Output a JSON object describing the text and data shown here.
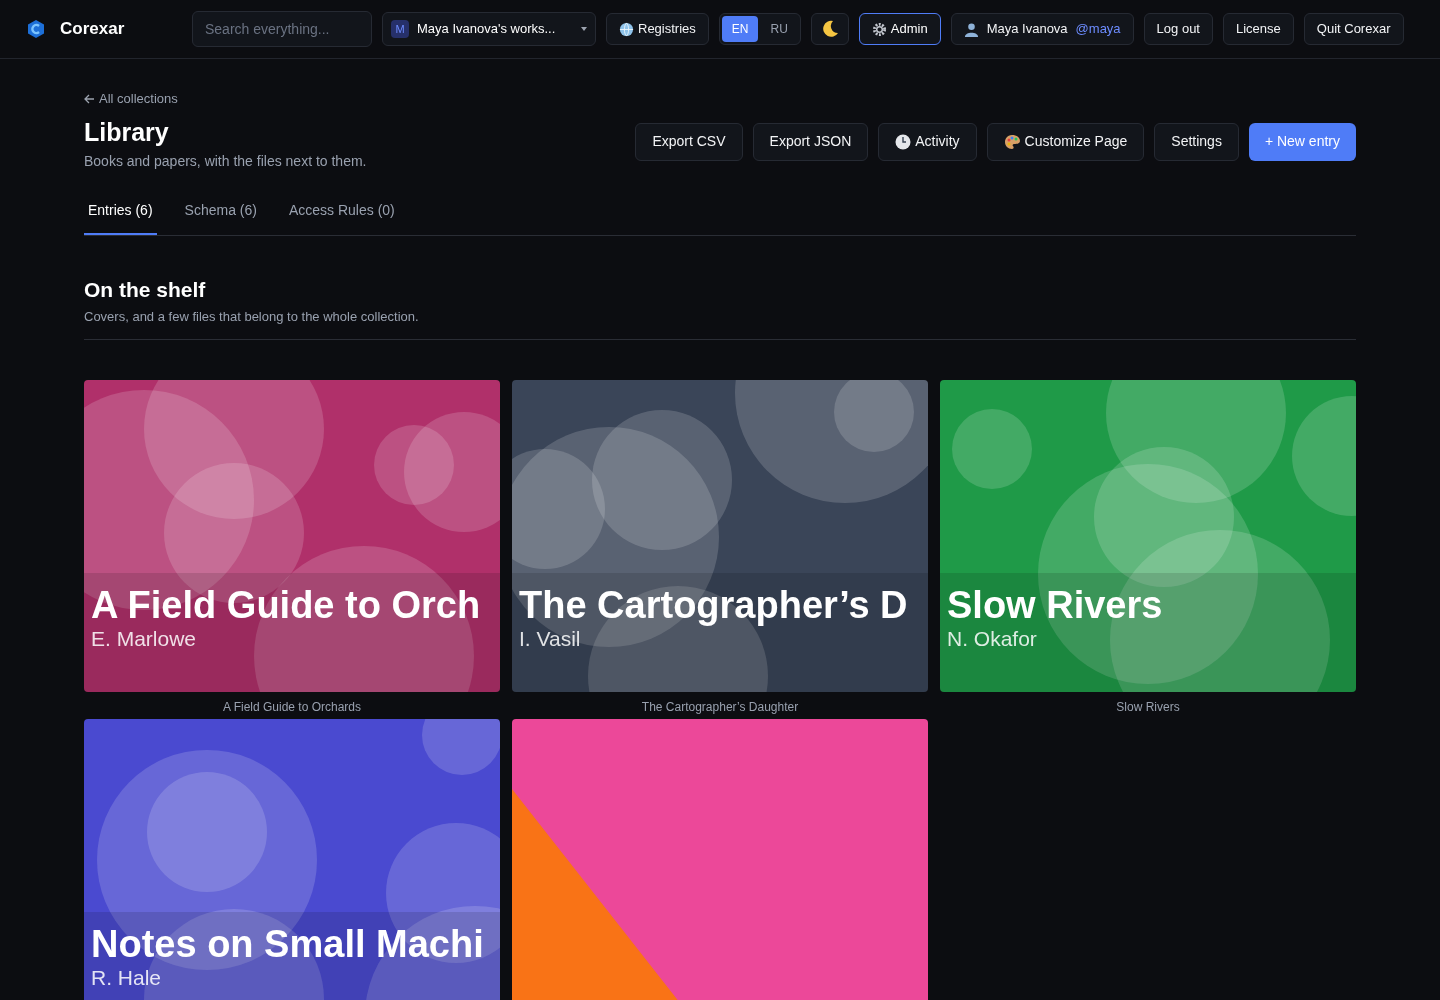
{
  "app": {
    "name": "Corexar"
  },
  "topbar": {
    "search": {
      "placeholder": "Search everything..."
    },
    "workspace": {
      "initial": "M",
      "label": "Maya Ivanova's works..."
    },
    "registries": "Registries",
    "languages": [
      {
        "label": "EN",
        "selected": true
      },
      {
        "label": "RU",
        "selected": false
      }
    ],
    "admin": "Admin",
    "user": {
      "name": "Maya Ivanova",
      "handle": "@maya"
    },
    "buttons": [
      "Log out",
      "License",
      "Quit Corexar"
    ]
  },
  "breadcrumb": "All collections",
  "page": {
    "title": "Library",
    "subtitle": "Books and papers, with the files next to them.",
    "actions": [
      {
        "label": "Export CSV",
        "kind": "plain"
      },
      {
        "label": "Export JSON",
        "kind": "plain"
      },
      {
        "label": "Activity",
        "kind": "clock"
      },
      {
        "label": "Customize Page",
        "kind": "palette"
      },
      {
        "label": "Settings",
        "kind": "plain"
      },
      {
        "label": "+ New entry",
        "kind": "primary"
      }
    ]
  },
  "tabs": [
    {
      "label": "Entries (6)",
      "selected": true
    },
    {
      "label": "Schema (6)",
      "selected": false
    },
    {
      "label": "Access Rules (0)",
      "selected": false
    }
  ],
  "section": {
    "title": "On the shelf",
    "subtitle": "Covers, and a few files that belong to the whole collection."
  },
  "entries": [
    {
      "kind": "bubbles",
      "color": "#b0306a",
      "cover_title": "A Field Guide to Orch",
      "cover_author": "E. Marlowe",
      "caption": "A Field Guide to Orchards"
    },
    {
      "kind": "bubbles",
      "color": "#3a4558",
      "cover_title": "The Cartographer’s D",
      "cover_author": "I. Vasil",
      "caption": "The Cartographer’s Daughter"
    },
    {
      "kind": "bubbles",
      "color": "#1f9a48",
      "cover_title": "Slow Rivers",
      "cover_author": "N. Okafor",
      "caption": "Slow Rivers"
    },
    {
      "kind": "bubbles",
      "color": "#4a4ad0",
      "cover_title": "Notes on Small Machi",
      "cover_author": "R. Hale"
    },
    {
      "kind": "gradient",
      "color": "#ec4899"
    }
  ]
}
